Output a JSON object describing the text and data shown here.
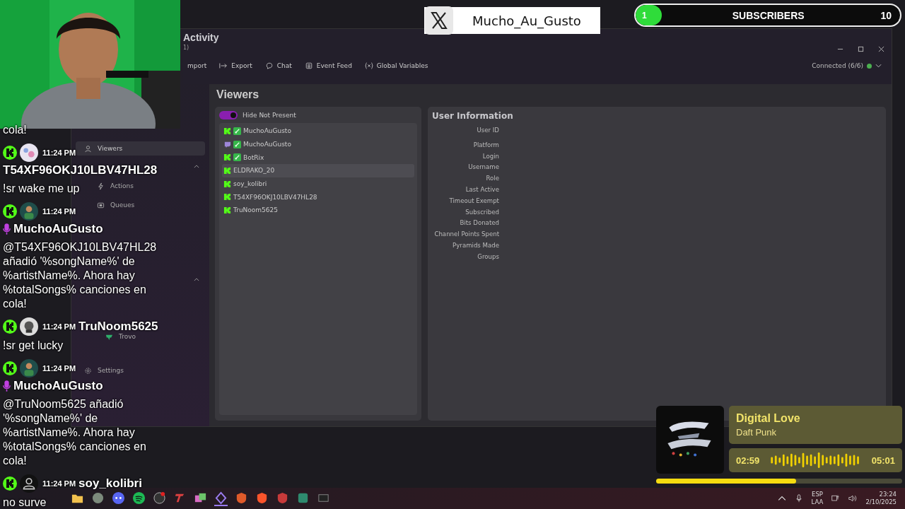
{
  "x_badge": {
    "handle": "Mucho_Au_Gusto"
  },
  "subscriber_goal": {
    "current": "1",
    "label": "SUBSCRIBERS",
    "goal": "10",
    "level": 0.1
  },
  "app": {
    "title": "Activity",
    "subtitle": "1)",
    "toolbar": [
      {
        "label": "mport",
        "kind": "plain"
      },
      {
        "label": "Export",
        "kind": "export"
      },
      {
        "label": "Chat",
        "kind": "chat"
      },
      {
        "label": "Event Feed",
        "kind": "feed"
      },
      {
        "label": "Global Variables",
        "kind": "variables"
      }
    ],
    "connection": {
      "label": "Connected (6/6)",
      "color": "#4caf50"
    },
    "sidebar": {
      "items": [
        {
          "label": "Viewers",
          "kind": "person",
          "selected": true
        },
        {
          "label": "Actions",
          "kind": "bolt",
          "selected": false
        },
        {
          "label": "Queues",
          "kind": "queue",
          "selected": false
        },
        {
          "label": "Trovo",
          "kind": "trovo",
          "selected": false
        },
        {
          "label": "Settings",
          "kind": "gear",
          "selected": false
        }
      ]
    },
    "viewers": {
      "title": "Viewers",
      "toggle": {
        "label": "Hide Not Present",
        "on": true
      },
      "rows": [
        {
          "name": "MuchoAuGusto",
          "kind": "kick",
          "bot": true,
          "highlighted": false
        },
        {
          "name": "MuchoAuGusto",
          "kind": "twitch",
          "bot": true,
          "highlighted": false
        },
        {
          "name": "BotRix",
          "kind": "kick",
          "bot": true,
          "highlighted": false
        },
        {
          "name": "ELDRAKO_20",
          "kind": "kick",
          "bot": false,
          "highlighted": true
        },
        {
          "name": "soy_kolibri",
          "kind": "kick",
          "bot": false,
          "highlighted": false
        },
        {
          "name": "T54XF96OKJ10LBV47HL28",
          "kind": "kick",
          "bot": false,
          "highlighted": false
        },
        {
          "name": "TruNoom5625",
          "kind": "kick",
          "bot": false,
          "highlighted": false
        }
      ]
    },
    "user_information": {
      "title": "User Information",
      "fields": [
        "User ID",
        "Platform",
        "Login",
        "Username",
        "Role",
        "Last Active",
        "Timeout Exempt",
        "Subscribed",
        "Bits Donated",
        "Channel Points Spent",
        "Pyramids Made",
        "Groups"
      ]
    }
  },
  "chat": [
    {
      "kind": "fragment",
      "message": "cola!"
    },
    {
      "kind": "art",
      "time": "11:24 PM",
      "user": "T54XF96OKJ10LBV47HL28",
      "mic": false,
      "message": "!sr wake me up"
    },
    {
      "kind": "man",
      "time": "11:24 PM",
      "user": "MuchoAuGusto",
      "mic": true,
      "message": "@T54XF96OKJ10LBV47HL28 añadió '%songName%' de %artistName%. Ahora hay %totalSongs% canciones en cola!"
    },
    {
      "kind": "skull",
      "time": "11:24 PM",
      "user": "TruNoom5625",
      "mic": false,
      "message": "!sr get lucky"
    },
    {
      "kind": "man",
      "time": "11:24 PM",
      "user": "MuchoAuGusto",
      "mic": true,
      "message": "@TruNoom5625 añadió '%songName%' de %artistName%. Ahora hay %totalSongs% canciones en cola!"
    },
    {
      "kind": "person",
      "time": "11:24 PM",
      "user": "soy_kolibri",
      "mic": false,
      "message": "no surve"
    }
  ],
  "now_playing": {
    "title": "Digital Love",
    "artist": "Daft Punk",
    "elapsed": "02:59",
    "total": "05:01",
    "level": 0.57
  },
  "taskbar": {
    "tray": {
      "language": "ESP",
      "layout": "LAA",
      "time": "23:24",
      "date": "2/10/2025"
    }
  }
}
